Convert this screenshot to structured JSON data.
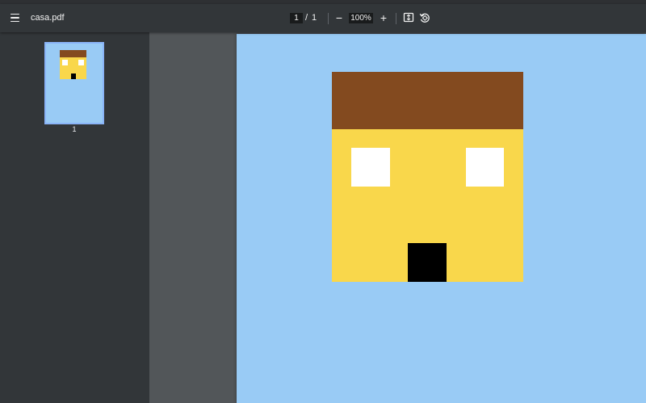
{
  "toolbar": {
    "title": "casa.pdf",
    "current_page": "1",
    "page_separator": "/",
    "total_pages": "1",
    "zoom": "100%",
    "zoom_out_glyph": "−",
    "zoom_in_glyph": "+"
  },
  "icons": {
    "menu": "menu-icon",
    "fit": "fit-to-page-icon",
    "rotate": "rotate-counterclockwise-icon"
  },
  "sidebar": {
    "thumbnails": [
      {
        "page_number": "1"
      }
    ]
  },
  "colors": {
    "page_background": "#99cbf5",
    "hair": "#834a1f",
    "face": "#f9d74b",
    "eye": "#ffffff",
    "mouth": "#000000",
    "toolbar": "#323639",
    "viewer_background": "#525659",
    "thumbnail_border": "#8ab4f8"
  }
}
